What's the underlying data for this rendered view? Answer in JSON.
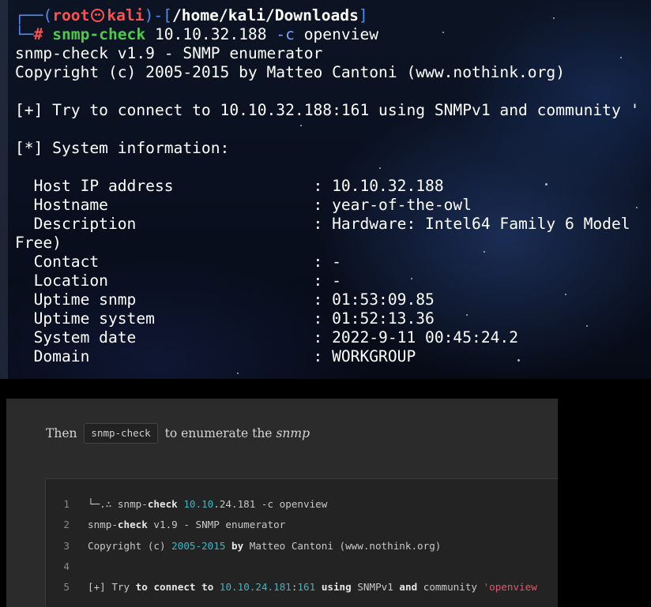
{
  "terminal": {
    "prompt": {
      "corner_top": "┌──(",
      "user": "root",
      "host": "kali",
      "close_paren": ")-[",
      "path": "/home/kali/Downloads",
      "close_bracket": "]",
      "corner_bottom": "└─",
      "hash": "#",
      "command": "snmp-check",
      "args_ip": " 10.10.32.188 ",
      "flag": "-c",
      "flag_value": " openview"
    },
    "lines": [
      "snmp-check v1.9 - SNMP enumerator",
      "Copyright (c) 2005-2015 by Matteo Cantoni (www.nothink.org)",
      "",
      "[+] Try to connect to 10.10.32.188:161 using SNMPv1 and community '",
      "",
      "[*] System information:",
      "",
      "  Host IP address               : 10.10.32.188",
      "  Hostname                      : year-of-the-owl",
      "  Description                   : Hardware: Intel64 Family 6 Model",
      "Free)",
      "  Contact                       : -",
      "  Location                      : -",
      "  Uptime snmp                   : 01:53:09.85",
      "  Uptime system                 : 01:52:13.36",
      "  System date                   : 2022-9-11 00:45:24.2",
      "  Domain                        : WORKGROUP"
    ]
  },
  "blog": {
    "intro_before": "Then",
    "intro_code": "snmp-check",
    "intro_after": "to enumerate the",
    "intro_em": "snmp",
    "code_lines": [
      {
        "num": "1",
        "parts": [
          {
            "t": "└─.∴ snmp-",
            "c": ""
          },
          {
            "t": "check",
            "c": "k"
          },
          {
            "t": " ",
            "c": ""
          },
          {
            "t": "10.10",
            "c": "n"
          },
          {
            "t": ".24.181 -c openview",
            "c": ""
          }
        ]
      },
      {
        "num": "2",
        "parts": [
          {
            "t": "snmp-",
            "c": ""
          },
          {
            "t": "check",
            "c": "k"
          },
          {
            "t": " v1.9 - SNMP enumerator",
            "c": ""
          }
        ]
      },
      {
        "num": "3",
        "parts": [
          {
            "t": "Copyright (c) ",
            "c": ""
          },
          {
            "t": "2005-2015",
            "c": "n"
          },
          {
            "t": " ",
            "c": ""
          },
          {
            "t": "by",
            "c": "k"
          },
          {
            "t": " Matteo Cantoni (www.nothink.org)",
            "c": ""
          }
        ]
      },
      {
        "num": "4",
        "parts": []
      },
      {
        "num": "5",
        "parts": [
          {
            "t": "[+] Try ",
            "c": ""
          },
          {
            "t": "to",
            "c": "k"
          },
          {
            "t": " ",
            "c": ""
          },
          {
            "t": "connect",
            "c": "k"
          },
          {
            "t": " ",
            "c": ""
          },
          {
            "t": "to",
            "c": "k"
          },
          {
            "t": " ",
            "c": ""
          },
          {
            "t": "10.10.24.181",
            "c": "n"
          },
          {
            "t": ":",
            "c": ""
          },
          {
            "t": "161",
            "c": "n"
          },
          {
            "t": " ",
            "c": ""
          },
          {
            "t": "using",
            "c": "k"
          },
          {
            "t": " SNMPv1 ",
            "c": ""
          },
          {
            "t": "and",
            "c": "k"
          },
          {
            "t": " community ",
            "c": ""
          },
          {
            "t": "'openview",
            "c": "s"
          }
        ]
      }
    ]
  }
}
